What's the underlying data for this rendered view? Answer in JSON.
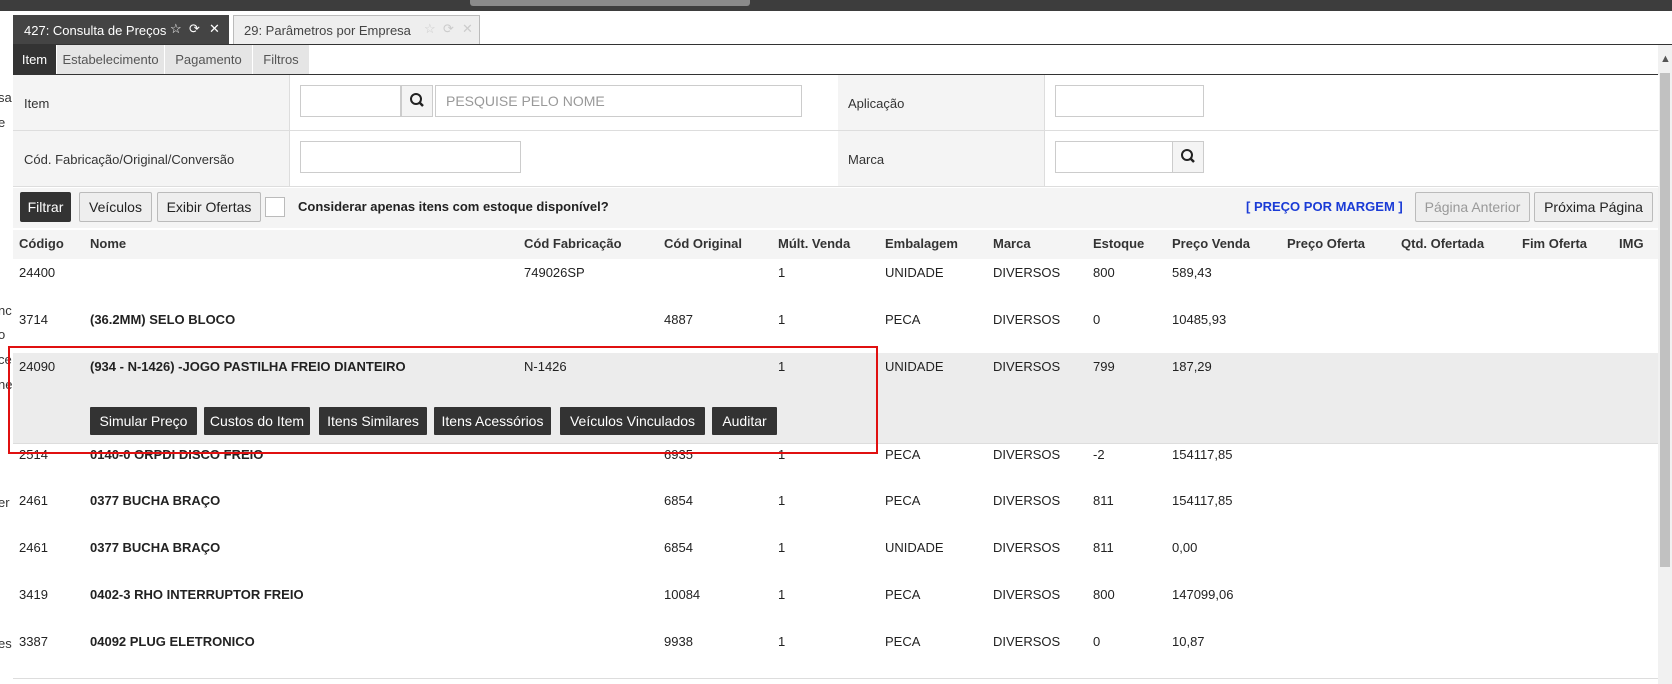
{
  "window_tabs": [
    {
      "label": "427: Consulta de Preços"
    },
    {
      "label": "29: Parâmetros por Empresa"
    }
  ],
  "icons": {
    "star": "☆",
    "refresh": "⟳",
    "close": "✕",
    "search": "search-icon"
  },
  "left_strip": [
    "sa",
    "e",
    "nc",
    "o",
    "ce",
    "ne",
    "er",
    "es"
  ],
  "sub_tabs": [
    "Item",
    "Estabelecimento",
    "Pagamento",
    "Filtros"
  ],
  "form": {
    "item_label": "Item",
    "item_code_value": "",
    "item_name_placeholder": "PESQUISE PELO NOME",
    "aplicacao_label": "Aplicação",
    "aplicacao_value": "",
    "cod_label": "Cód. Fabricação/Original/Conversão",
    "cod_value": "",
    "marca_label": "Marca",
    "marca_value": ""
  },
  "toolbar": {
    "filtrar": "Filtrar",
    "veiculos": "Veículos",
    "exibir_ofertas": "Exibir Ofertas",
    "checkbox_label": "Considerar apenas itens com estoque disponível?",
    "checkbox_checked": false,
    "margem_link": "[ PREÇO POR MARGEM ]",
    "pagina_anterior": "Página Anterior",
    "proxima_pagina": "Próxima Página"
  },
  "table": {
    "headers": [
      "Código",
      "Nome",
      "Cód Fabricação",
      "Cód Original",
      "Múlt. Venda",
      "Embalagem",
      "Marca",
      "Estoque",
      "Preço Venda",
      "Preço Oferta",
      "Qtd. Ofertada",
      "Fim Oferta",
      "IMG"
    ],
    "rows": [
      [
        "24400",
        "",
        "749026SP",
        "",
        "1",
        "UNIDADE",
        "DIVERSOS",
        "800",
        "589,43",
        "",
        "",
        "",
        ""
      ],
      [
        "3714",
        "(36.2MM) SELO BLOCO",
        "",
        "4887",
        "1",
        "PECA",
        "DIVERSOS",
        "0",
        "10485,93",
        "",
        "",
        "",
        ""
      ],
      [
        "24090",
        "(934 - N-1426) -JOGO PASTILHA FREIO DIANTEIRO",
        "N-1426",
        "",
        "1",
        "UNIDADE",
        "DIVERSOS",
        "799",
        "187,29",
        "",
        "",
        "",
        ""
      ],
      [
        "2514",
        "0140-0 ORPDI DISCO FREIO",
        "",
        "6935",
        "1",
        "PECA",
        "DIVERSOS",
        "-2",
        "154117,85",
        "",
        "",
        "",
        ""
      ],
      [
        "2461",
        "0377 BUCHA BRAÇO",
        "",
        "6854",
        "1",
        "PECA",
        "DIVERSOS",
        "811",
        "154117,85",
        "",
        "",
        "",
        ""
      ],
      [
        "2461",
        "0377 BUCHA BRAÇO",
        "",
        "6854",
        "1",
        "UNIDADE",
        "DIVERSOS",
        "811",
        "0,00",
        "",
        "",
        "",
        ""
      ],
      [
        "3419",
        "0402-3 RHO INTERRUPTOR FREIO",
        "",
        "10084",
        "1",
        "PECA",
        "DIVERSOS",
        "800",
        "147099,06",
        "",
        "",
        "",
        ""
      ],
      [
        "3387",
        "04092 PLUG ELETRONICO",
        "",
        "9938",
        "1",
        "PECA",
        "DIVERSOS",
        "0",
        "10,87",
        "",
        "",
        "",
        ""
      ]
    ],
    "selected_row": 2
  },
  "row_actions": [
    "Simular Preço",
    "Custos do Item",
    "Itens Similares",
    "Itens Acessórios",
    "Veículos Vinculados",
    "Auditar"
  ],
  "colors": {
    "dark": "#333333",
    "link": "#1a3bd6",
    "highlight": "#e01010"
  }
}
